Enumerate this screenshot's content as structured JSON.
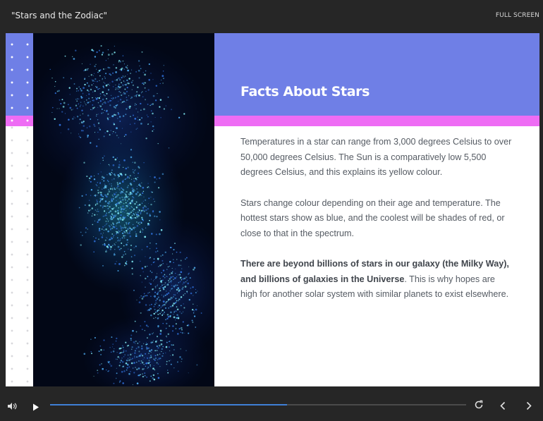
{
  "player": {
    "course_title": "\"Stars and the Zodiac\"",
    "fullscreen_label": "FULL SCREEN",
    "progress": 0.57,
    "progress_color": "#3f7fd6",
    "icons": {
      "volume": "volume-icon",
      "play": "play-icon",
      "replay": "replay-icon",
      "prev": "chevron-left-icon",
      "next": "chevron-right-icon"
    }
  },
  "slide": {
    "title": "Facts About Stars",
    "colors": {
      "header": "#6f7fe6",
      "accent": "#ee6cf4",
      "text": "#555b63"
    },
    "paragraphs": [
      "Temperatures in a star can range from 3,000 degrees Celsius to over 50,000 degrees Celsius. The Sun is a comparatively low 5,500 degrees Celsius, and this explains its yellow colour.",
      "Stars change colour depending on their age and temperature. The hottest stars show as blue, and the coolest will be shades of red, or close to that in the spectrum."
    ],
    "para3_bold": "There are beyond billions of stars in our galaxy (the Milky Way), and billions of galaxies in the Universe",
    "para3_rest": ". This is why hopes are high for another solar system with similar planets to exist elsewhere."
  }
}
